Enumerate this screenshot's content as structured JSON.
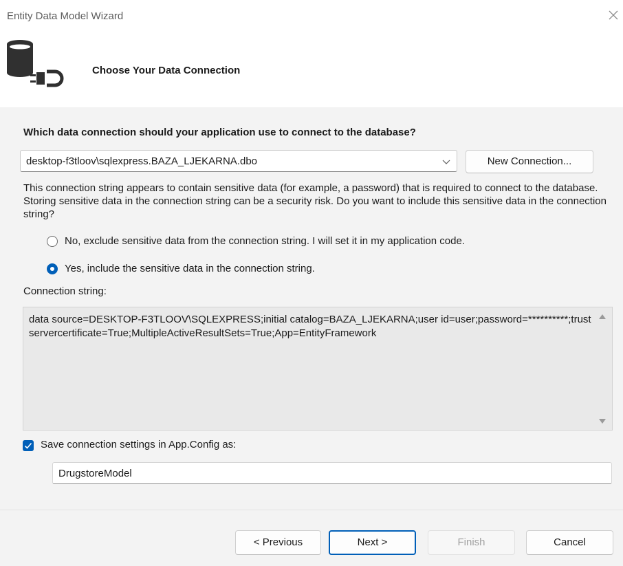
{
  "window": {
    "title": "Entity Data Model Wizard"
  },
  "header": {
    "title": "Choose Your Data Connection"
  },
  "question": "Which data connection should your application use to connect to the database?",
  "connection_select": {
    "value": "desktop-f3tloov\\sqlexpress.BAZA_LJEKARNA.dbo"
  },
  "new_connection_label": "New Connection...",
  "warning": "This connection string appears to contain sensitive data (for example, a password) that is required to connect to the database. Storing sensitive data in the connection string can be a security risk. Do you want to include this sensitive data in the connection string?",
  "options": {
    "exclude_label": "No, exclude sensitive data from the connection string. I will set it in my application code.",
    "include_label": "Yes, include the sensitive data in the connection string.",
    "selected": "include"
  },
  "connection_string_label": "Connection string:",
  "connection_string": "data source=DESKTOP-F3TLOOV\\SQLEXPRESS;initial catalog=BAZA_LJEKARNA;user id=user;password=**********;trustservercertificate=True;MultipleActiveResultSets=True;App=EntityFramework",
  "save_settings": {
    "checked": true,
    "label": "Save connection settings in App.Config as:",
    "value": "DrugstoreModel"
  },
  "footer": {
    "previous": "< Previous",
    "next": "Next >",
    "finish": "Finish",
    "cancel": "Cancel"
  },
  "colors": {
    "accent": "#005fb8",
    "content_bg": "#f3f3f3",
    "textbox_bg": "#e9e9e9"
  }
}
